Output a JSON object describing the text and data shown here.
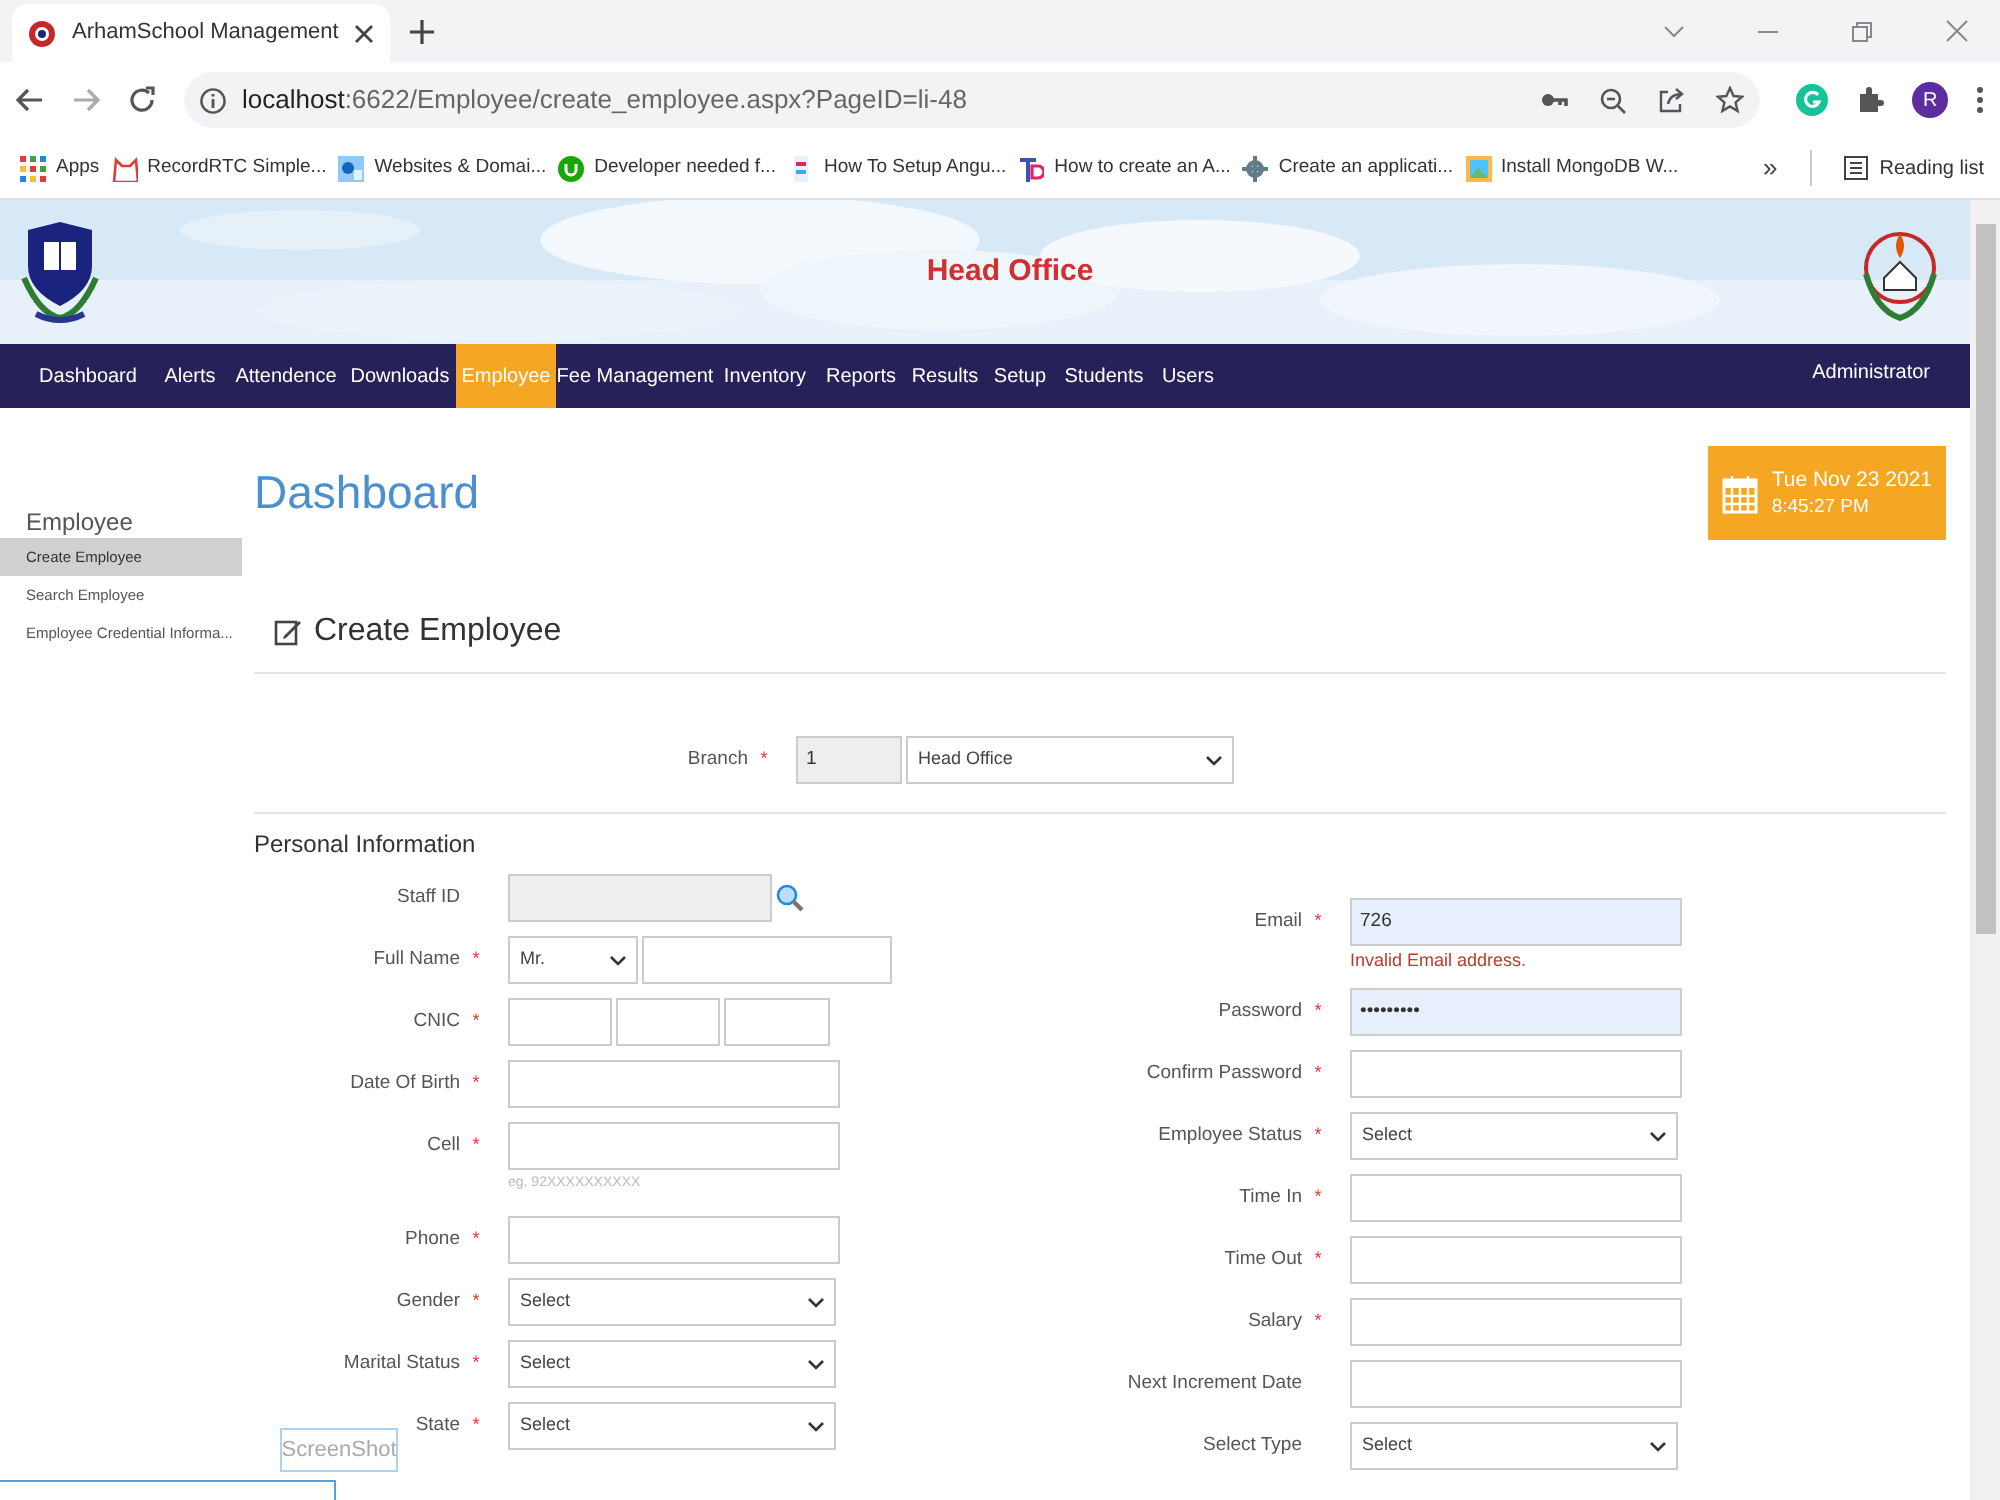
{
  "browser": {
    "tab_title": "ArhamSchool Management",
    "url_host": "localhost",
    "url_path": ":6622/Employee/create_employee.aspx?PageID=li-48",
    "bookmarks": [
      {
        "label": "Apps"
      },
      {
        "label": "RecordRTC Simple..."
      },
      {
        "label": "Websites & Domai..."
      },
      {
        "label": "Developer needed f..."
      },
      {
        "label": "How To Setup Angu..."
      },
      {
        "label": "How to create an A..."
      },
      {
        "label": "Create an applicati..."
      },
      {
        "label": "Install MongoDB W..."
      }
    ],
    "overflow": "»",
    "reading_list": "Reading list",
    "avatar": "R"
  },
  "header": {
    "title": "Head Office",
    "user": "Administrator",
    "nav": [
      {
        "label": "Dashboard",
        "selected": false
      },
      {
        "label": "Alerts",
        "selected": false
      },
      {
        "label": "Attendence",
        "selected": false
      },
      {
        "label": "Downloads",
        "selected": false
      },
      {
        "label": "Employee",
        "selected": true
      },
      {
        "label": "Fee Management",
        "selected": false
      },
      {
        "label": "Inventory",
        "selected": false
      },
      {
        "label": "Reports",
        "selected": false
      },
      {
        "label": "Results",
        "selected": false
      },
      {
        "label": "Setup",
        "selected": false
      },
      {
        "label": "Students",
        "selected": false
      },
      {
        "label": "Users",
        "selected": false
      }
    ]
  },
  "sidebar": {
    "heading": "Employee",
    "items": [
      {
        "label": "Create Employee",
        "selected": true
      },
      {
        "label": "Search Employee",
        "selected": false
      },
      {
        "label": "Employee Credential Informa...",
        "selected": false
      }
    ]
  },
  "page_title": "Dashboard",
  "clock": {
    "date": "Tue Nov 23 2021",
    "time": "8:45:27 PM"
  },
  "form_title": "Create Employee",
  "branch": {
    "label": "Branch",
    "required_mark": "*",
    "code": "1",
    "value": "Head Office"
  },
  "section_title": "Personal Information",
  "left_fields": [
    {
      "kind": "lookup",
      "label": "Staff ID"
    },
    {
      "kind": "name",
      "label": "Full Name",
      "required_mark": "*",
      "title": "Mr."
    },
    {
      "kind": "cnic",
      "label": "CNIC",
      "required_mark": "*"
    },
    {
      "kind": "text",
      "label": "Date Of Birth",
      "required_mark": "*"
    },
    {
      "kind": "text",
      "label": "Cell",
      "required_mark": "*",
      "hint": "eg. 92XXXXXXXXXX"
    },
    {
      "kind": "text",
      "label": "Phone",
      "required_mark": "*"
    },
    {
      "kind": "select",
      "label": "Gender",
      "required_mark": "*",
      "value": "Select"
    },
    {
      "kind": "select",
      "label": "Marital Status",
      "required_mark": "*",
      "value": "Select"
    },
    {
      "kind": "select",
      "label": "State",
      "required_mark": "*",
      "value": "Select"
    }
  ],
  "right_fields": [
    {
      "kind": "text",
      "label": "Email",
      "required_mark": "*",
      "value": "726",
      "autofilled": true,
      "error": "Invalid Email address."
    },
    {
      "kind": "text",
      "label": "Password",
      "required_mark": "*",
      "value": "•••••••••",
      "autofilled": true
    },
    {
      "kind": "text",
      "label": "Confirm Password",
      "required_mark": "*"
    },
    {
      "kind": "select",
      "label": "Employee Status",
      "required_mark": "*",
      "value": "Select"
    },
    {
      "kind": "text",
      "label": "Time In",
      "required_mark": "*"
    },
    {
      "kind": "text",
      "label": "Time Out",
      "required_mark": "*"
    },
    {
      "kind": "text",
      "label": "Salary",
      "required_mark": "*"
    },
    {
      "kind": "text",
      "label": "Next Increment Date"
    },
    {
      "kind": "select",
      "label": "Select Type",
      "value": "Select"
    }
  ],
  "recorder": {
    "button": "ScreenShot"
  }
}
